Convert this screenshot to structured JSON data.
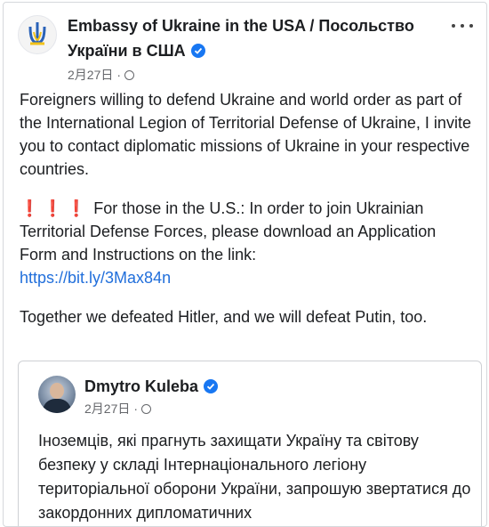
{
  "post": {
    "page_name": "Embassy of Ukraine in the USA / Посольство України в США",
    "date": "2月27日",
    "dot": "·",
    "paragraphs": {
      "p1": "Foreigners willing to defend Ukraine and world order as part of the International Legion of Territorial Defense of Ukraine, I invite you to contact diplomatic missions of Ukraine in your respective countries.",
      "p2_alarm": "❗❗❗",
      "p2": "For those in the U.S.: In order to join Ukrainian Territorial Defense Forces, please download an Application Form and Instructions on the link:",
      "p2_link": "https://bit.ly/3Max84n",
      "p3": "Together we defeated Hitler, and we will defeat Putin, too."
    }
  },
  "shared_post": {
    "author": "Dmytro Kuleba",
    "date": "2月27日",
    "dot": "·",
    "text": "Іноземців, які прагнуть захищати Україну та світову безпеку у складі Інтернаціонального легіону територіальної оборони України, запрошую звертатися до закордонних дипломатичних"
  },
  "icons": {
    "verified": "verified-badge-icon",
    "audience": "globe-icon",
    "more": "more-options-icon"
  },
  "colors": {
    "link": "#216fdb",
    "verified": "#1877f2",
    "alarm": "#e41e3f",
    "secondary_text": "#65676b"
  }
}
